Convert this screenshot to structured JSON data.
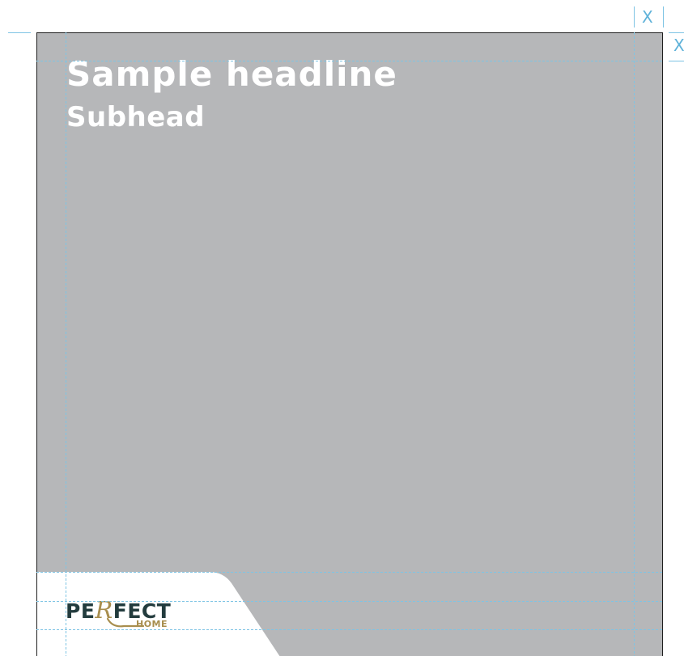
{
  "headline": "Sample headline",
  "subhead": "Subhead",
  "logo": {
    "main_before": "PE",
    "main_r": "R",
    "main_after": "FECT",
    "sub": "HOME"
  },
  "margin_labels": {
    "top": "X",
    "side": "X"
  },
  "colors": {
    "background": "#b6b7b9",
    "text": "#ffffff",
    "guide": "#5fb2d9",
    "logo_dark": "#233c3e",
    "logo_gold": "#a88e4e"
  },
  "icons": [
    "perfect-home-logo"
  ]
}
